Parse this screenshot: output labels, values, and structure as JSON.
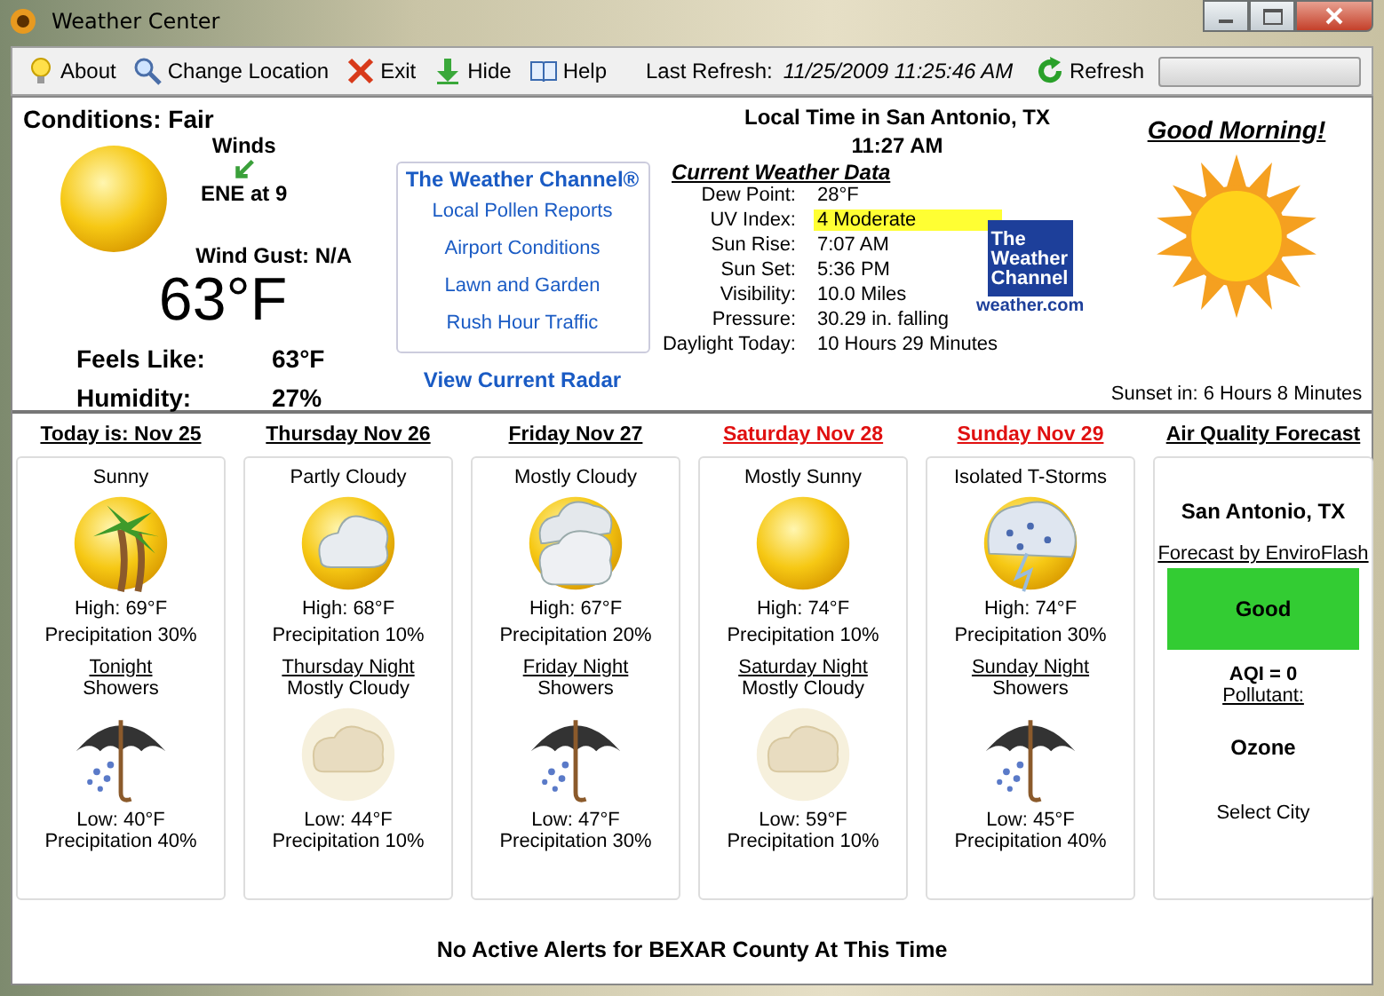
{
  "window": {
    "title": "Weather Center"
  },
  "toolbar": {
    "items": [
      {
        "label": "About",
        "kind": "bulb"
      },
      {
        "label": "Change Location",
        "kind": "magnifier"
      },
      {
        "label": "Exit",
        "kind": "x"
      },
      {
        "label": "Hide",
        "kind": "down"
      },
      {
        "label": "Help",
        "kind": "book"
      }
    ],
    "last_refresh_label": "Last Refresh:",
    "last_refresh": "11/25/2009 11:25:46 AM",
    "refresh": "Refresh",
    "progress": {
      "level": 0
    }
  },
  "conditions": {
    "title": "Conditions: Fair",
    "winds_label": "Winds",
    "wind": "ENE at 9",
    "wind_gust": "Wind Gust:  N/A",
    "temperature": "63°F",
    "feels_like_label": "Feels Like:",
    "feels_like": "63°F",
    "humidity_label": "Humidity:",
    "humidity": "27%"
  },
  "links": {
    "title": "The Weather Channel®",
    "items": [
      "Local Pollen Reports",
      "Airport Conditions",
      "Lawn and Garden",
      "Rush Hour Traffic"
    ],
    "radar": "View Current Radar"
  },
  "local_time": {
    "label": "Local Time in San Antonio, TX",
    "time": "11:27 AM"
  },
  "current_data": {
    "title": "Current Weather Data",
    "rows": [
      {
        "label": "Dew Point:",
        "value": "28°F",
        "highlight": false
      },
      {
        "label": "UV Index:",
        "value": "4 Moderate",
        "highlight": true
      },
      {
        "label": "Sun Rise:",
        "value": "7:07 AM",
        "highlight": false
      },
      {
        "label": "Sun Set:",
        "value": "5:36 PM",
        "highlight": false
      },
      {
        "label": "Visibility:",
        "value": "10.0 Miles",
        "highlight": false
      },
      {
        "label": "Pressure:",
        "value": "30.29 in. falling",
        "highlight": false
      },
      {
        "label": "Daylight Today:",
        "value": "10 Hours 29 Minutes",
        "highlight": false
      }
    ]
  },
  "logo": {
    "lines": [
      "The",
      "Weather",
      "Channel"
    ],
    "site": "weather.com"
  },
  "greeting": "Good Morning!",
  "sunset_in": "Sunset in: 6 Hours 8 Minutes",
  "forecast": [
    {
      "day": "Today is: Nov 25",
      "weekend": false,
      "condition": "Sunny",
      "high": "High: 69°F",
      "precip": "Precipitation 30%",
      "night": "Tonight",
      "night_condition": "Showers",
      "low": "Low: 40°F",
      "night_precip": "Precipitation 40%"
    },
    {
      "day": "Thursday Nov 26",
      "weekend": false,
      "condition": "Partly Cloudy",
      "high": "High: 68°F",
      "precip": "Precipitation 10%",
      "night": "Thursday Night",
      "night_condition": "Mostly Cloudy",
      "low": "Low: 44°F",
      "night_precip": "Precipitation 10%"
    },
    {
      "day": "Friday Nov 27",
      "weekend": false,
      "condition": "Mostly Cloudy",
      "high": "High: 67°F",
      "precip": "Precipitation 20%",
      "night": "Friday Night",
      "night_condition": "Showers",
      "low": "Low: 47°F",
      "night_precip": "Precipitation 30%"
    },
    {
      "day": "Saturday Nov 28",
      "weekend": true,
      "condition": "Mostly Sunny",
      "high": "High: 74°F",
      "precip": "Precipitation 10%",
      "night": "Saturday Night",
      "night_condition": "Mostly Cloudy",
      "low": "Low: 59°F",
      "night_precip": "Precipitation 10%"
    },
    {
      "day": "Sunday Nov 29",
      "weekend": true,
      "condition": "Isolated T-Storms",
      "high": "High: 74°F",
      "precip": "Precipitation 30%",
      "night": "Sunday Night",
      "night_condition": "Showers",
      "low": "Low: 45°F",
      "night_precip": "Precipitation 40%"
    }
  ],
  "air_quality": {
    "title": "Air Quality Forecast",
    "city": "San Antonio, TX",
    "source": "Forecast by EnviroFlash",
    "rating": "Good",
    "color": "#33cc33",
    "aqi": "AQI = 0",
    "pollutant_label": "Pollutant:",
    "pollutant": "Ozone",
    "select": "Select City"
  },
  "alert": "No Active Alerts for BEXAR County At This Time"
}
